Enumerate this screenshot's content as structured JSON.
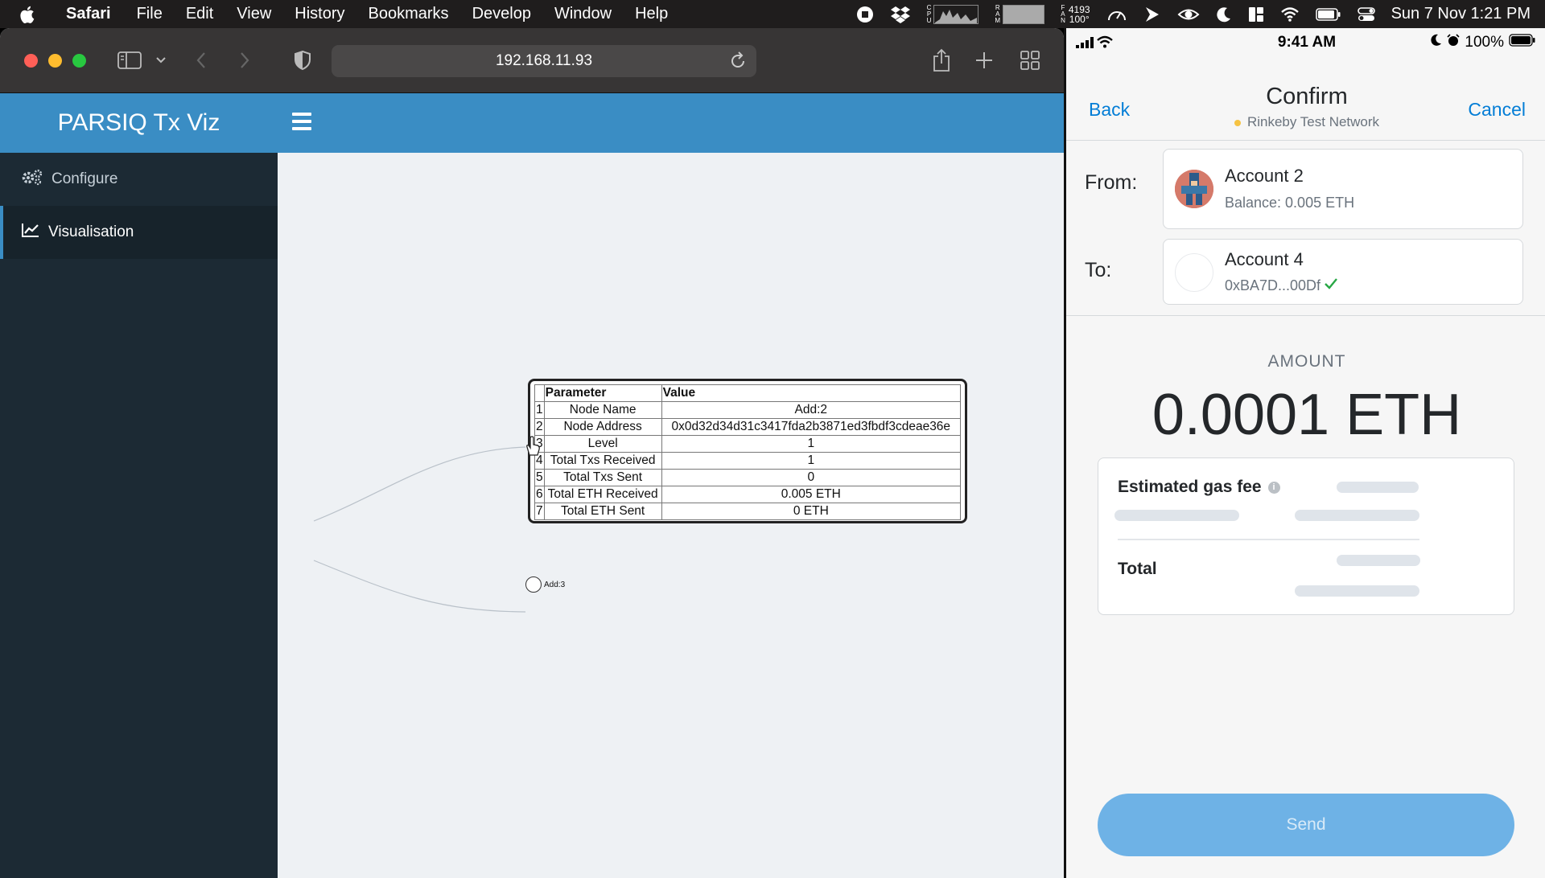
{
  "menubar": {
    "app_name": "Safari",
    "items": [
      "File",
      "Edit",
      "View",
      "History",
      "Bookmarks",
      "Develop",
      "Window",
      "Help"
    ],
    "cpu_label": "C\nP\nU",
    "ram_label": "R\nA\nM",
    "fan_label": "F\nA\nN",
    "fan_rpm": "4193",
    "temperature": "100°",
    "clock": "Sun 7 Nov  1:21 PM"
  },
  "browser": {
    "address": "192.168.11.93"
  },
  "webapp": {
    "brand": "PARSIQ Tx Viz",
    "sidebar": [
      {
        "label": "Configure",
        "icon": "gears-icon",
        "active": false
      },
      {
        "label": "Visualisation",
        "icon": "line-chart-icon",
        "active": true
      }
    ],
    "tooltip": {
      "headers": [
        "Parameter",
        "Value"
      ],
      "rows": [
        {
          "index": "1",
          "param": "Node Name",
          "value": "Add:2"
        },
        {
          "index": "2",
          "param": "Node Address",
          "value": "0x0d32d34d31c3417fda2b3871ed3fbdf3cdeae36e"
        },
        {
          "index": "3",
          "param": "Level",
          "value": "1"
        },
        {
          "index": "4",
          "param": "Total Txs Received",
          "value": "1"
        },
        {
          "index": "5",
          "param": "Total Txs Sent",
          "value": "0"
        },
        {
          "index": "6",
          "param": "Total ETH Received",
          "value": "0.005 ETH"
        },
        {
          "index": "7",
          "param": "Total ETH Sent",
          "value": "0 ETH"
        }
      ]
    },
    "node_label": "Add:3"
  },
  "phone": {
    "status": {
      "time": "9:41 AM",
      "battery": "100%"
    },
    "nav": {
      "back": "Back",
      "title": "Confirm",
      "network": "Rinkeby Test Network",
      "cancel": "Cancel"
    },
    "from": {
      "label": "From:",
      "account": "Account 2",
      "detail": "Balance: 0.005 ETH"
    },
    "to": {
      "label": "To:",
      "account": "Account 4",
      "detail": "0xBA7D...00Df"
    },
    "amount_label": "AMOUNT",
    "amount": "0.0001 ETH",
    "gas": {
      "title": "Estimated gas fee",
      "total": "Total"
    },
    "send": "Send",
    "colors": {
      "link": "#037dd6",
      "send_button": "#6eb2e6",
      "network_dot": "#f6c343",
      "verified_check": "#28a745"
    }
  }
}
